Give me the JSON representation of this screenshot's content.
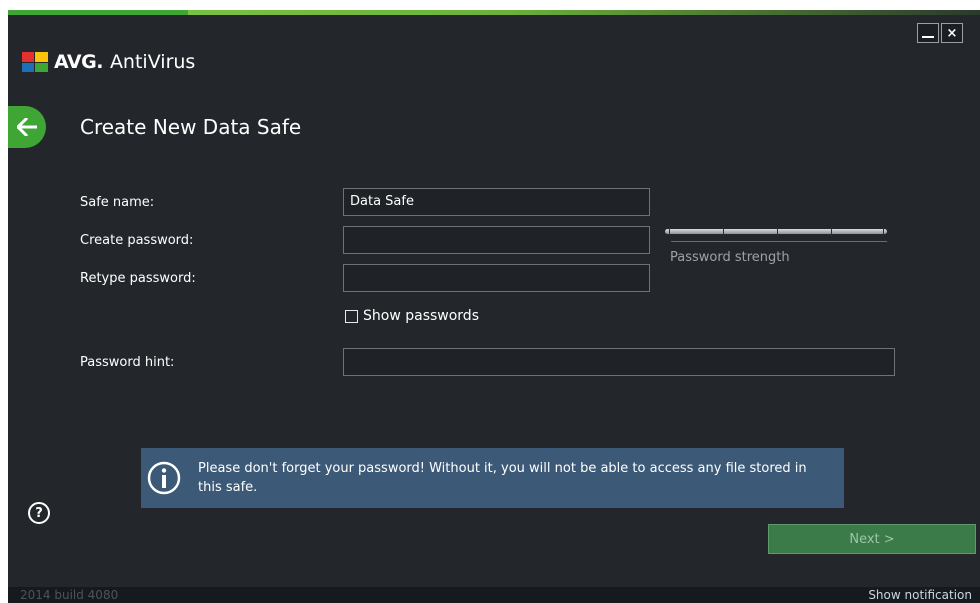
{
  "window": {
    "minimize_icon": "minimize-icon",
    "close_icon": "close-icon",
    "close_glyph": "×"
  },
  "header": {
    "brand": "AVG.",
    "product": "AntiVirus"
  },
  "page": {
    "back_icon": "arrow-left-icon",
    "title": "Create New Data Safe"
  },
  "form": {
    "safe_name_label": "Safe name:",
    "safe_name_value": "Data Safe",
    "create_password_label": "Create password:",
    "create_password_value": "",
    "retype_password_label": "Retype password:",
    "retype_password_value": "",
    "password_strength_label": "Password strength",
    "password_strength_level": 0,
    "show_passwords_label": "Show passwords",
    "show_passwords_checked": false,
    "password_hint_label": "Password hint:",
    "password_hint_value": ""
  },
  "info": {
    "icon": "info-icon",
    "message": "Please don't forget your password! Without it, you will not be able to access any file stored in this safe."
  },
  "help": {
    "icon": "help-icon",
    "glyph": "?"
  },
  "actions": {
    "next_label": "Next >"
  },
  "footer": {
    "build": "2014 build 4080",
    "show_notification": "Show notification"
  },
  "colors": {
    "accent_green": "#3fa535",
    "background": "#23272c",
    "info_bg": "#3c5a78",
    "next_bg": "#3a7b49"
  }
}
